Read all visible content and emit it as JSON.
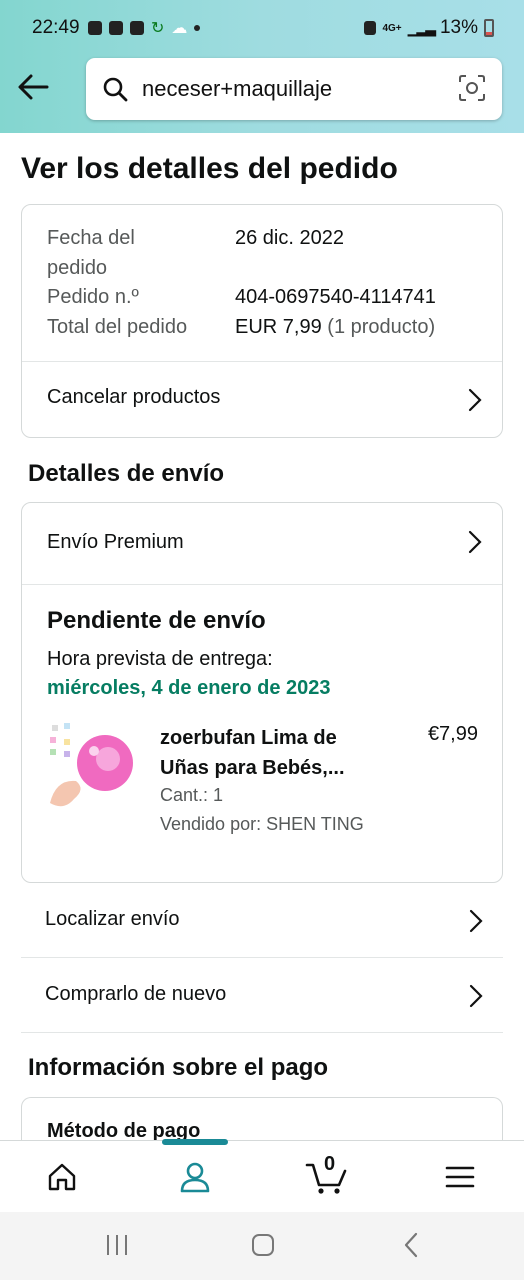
{
  "status_bar": {
    "time": "22:49",
    "battery": "13%",
    "network": "4G+"
  },
  "search": {
    "query": "neceser+maquillaje"
  },
  "page": {
    "title": "Ver los detalles del pedido"
  },
  "order_summary": {
    "date_label": "Fecha del",
    "date_label_2": "pedido",
    "date_value": "26 dic. 2022",
    "order_no_label": "Pedido n.º",
    "order_no_value": "404-0697540-4114741",
    "total_label": "Total del pedido",
    "total_value": "EUR 7,99",
    "total_count": "(1 producto)",
    "cancel_label": "Cancelar productos"
  },
  "shipping": {
    "section_title": "Detalles de envío",
    "method": "Envío Premium",
    "status": "Pendiente de envío",
    "eta_label": "Hora prevista de entrega:",
    "eta_date": "miércoles, 4 de enero de 2023",
    "product": {
      "name_line1": "zoerbufan Lima de",
      "name_line2": "Uñas para Bebés,...",
      "price": "€7,99",
      "qty": "Cant.: 1",
      "seller": "Vendido por: SHEN TING"
    }
  },
  "actions": {
    "track": "Localizar envío",
    "buy_again": "Comprarlo de nuevo"
  },
  "payment": {
    "section_title": "Información sobre el pago",
    "method_label": "Método de pago"
  },
  "bottom_nav": {
    "cart_count": "0"
  },
  "colors": {
    "accent": "#1a8a96",
    "delivery_green": "#067d62"
  }
}
